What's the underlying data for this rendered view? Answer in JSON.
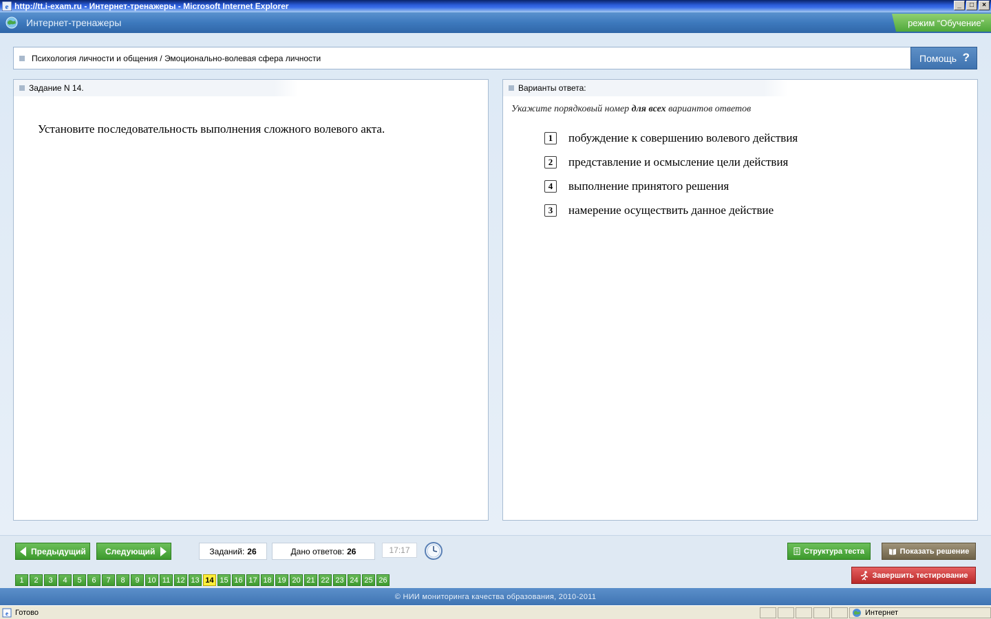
{
  "window": {
    "title": "http://tt.i-exam.ru - Интернет-тренажеры - Microsoft Internet Explorer",
    "minimize": "_",
    "maximize": "□",
    "close": "×"
  },
  "header": {
    "app_title": "Интернет-тренажеры",
    "mode_label": "режим “Обучение”"
  },
  "breadcrumb": "Психология личности и общения / Эмоционально-волевая сфера личности",
  "help_label": "Помощь",
  "help_icon": "?",
  "task": {
    "header": "Задание N 14.",
    "question": "Установите последовательность выполнения сложного волевого акта."
  },
  "answers_panel": {
    "header": "Варианты ответа:",
    "instruction_pre": "Укажите порядковый номер ",
    "instruction_bold": "для всех",
    "instruction_post": " вариантов ответов",
    "items": [
      {
        "order": "1",
        "text": "побуждение к совершению волевого действия"
      },
      {
        "order": "2",
        "text": "представление и осмысление цели действия"
      },
      {
        "order": "4",
        "text": "выполнение принятого решения"
      },
      {
        "order": "3",
        "text": "намерение осуществить данное действие"
      }
    ]
  },
  "toolbar": {
    "prev_label": "Предыдущий",
    "next_label": "Следующий",
    "tasks_label": "Заданий:",
    "tasks_count": "26",
    "answered_label": "Дано ответов:",
    "answered_count": "26",
    "timer": "17:17",
    "structure_label": "Структура теста",
    "solution_label": "Показать решение",
    "finish_label": "Завершить тестирование"
  },
  "pager": {
    "current": 14,
    "pages": [
      "1",
      "2",
      "3",
      "4",
      "5",
      "6",
      "7",
      "8",
      "9",
      "10",
      "11",
      "12",
      "13",
      "14",
      "15",
      "16",
      "17",
      "18",
      "19",
      "20",
      "21",
      "22",
      "23",
      "24",
      "25",
      "26"
    ]
  },
  "footer": "© НИИ мониторинга качества образования, 2010-2011",
  "status": {
    "left": "Готово",
    "zone": "Интернет"
  },
  "colors": {
    "accent_blue": "#3f74b3",
    "green_button": "#3d9a2d",
    "current_page": "#ffee3a",
    "finish_red": "#b92a2a"
  }
}
